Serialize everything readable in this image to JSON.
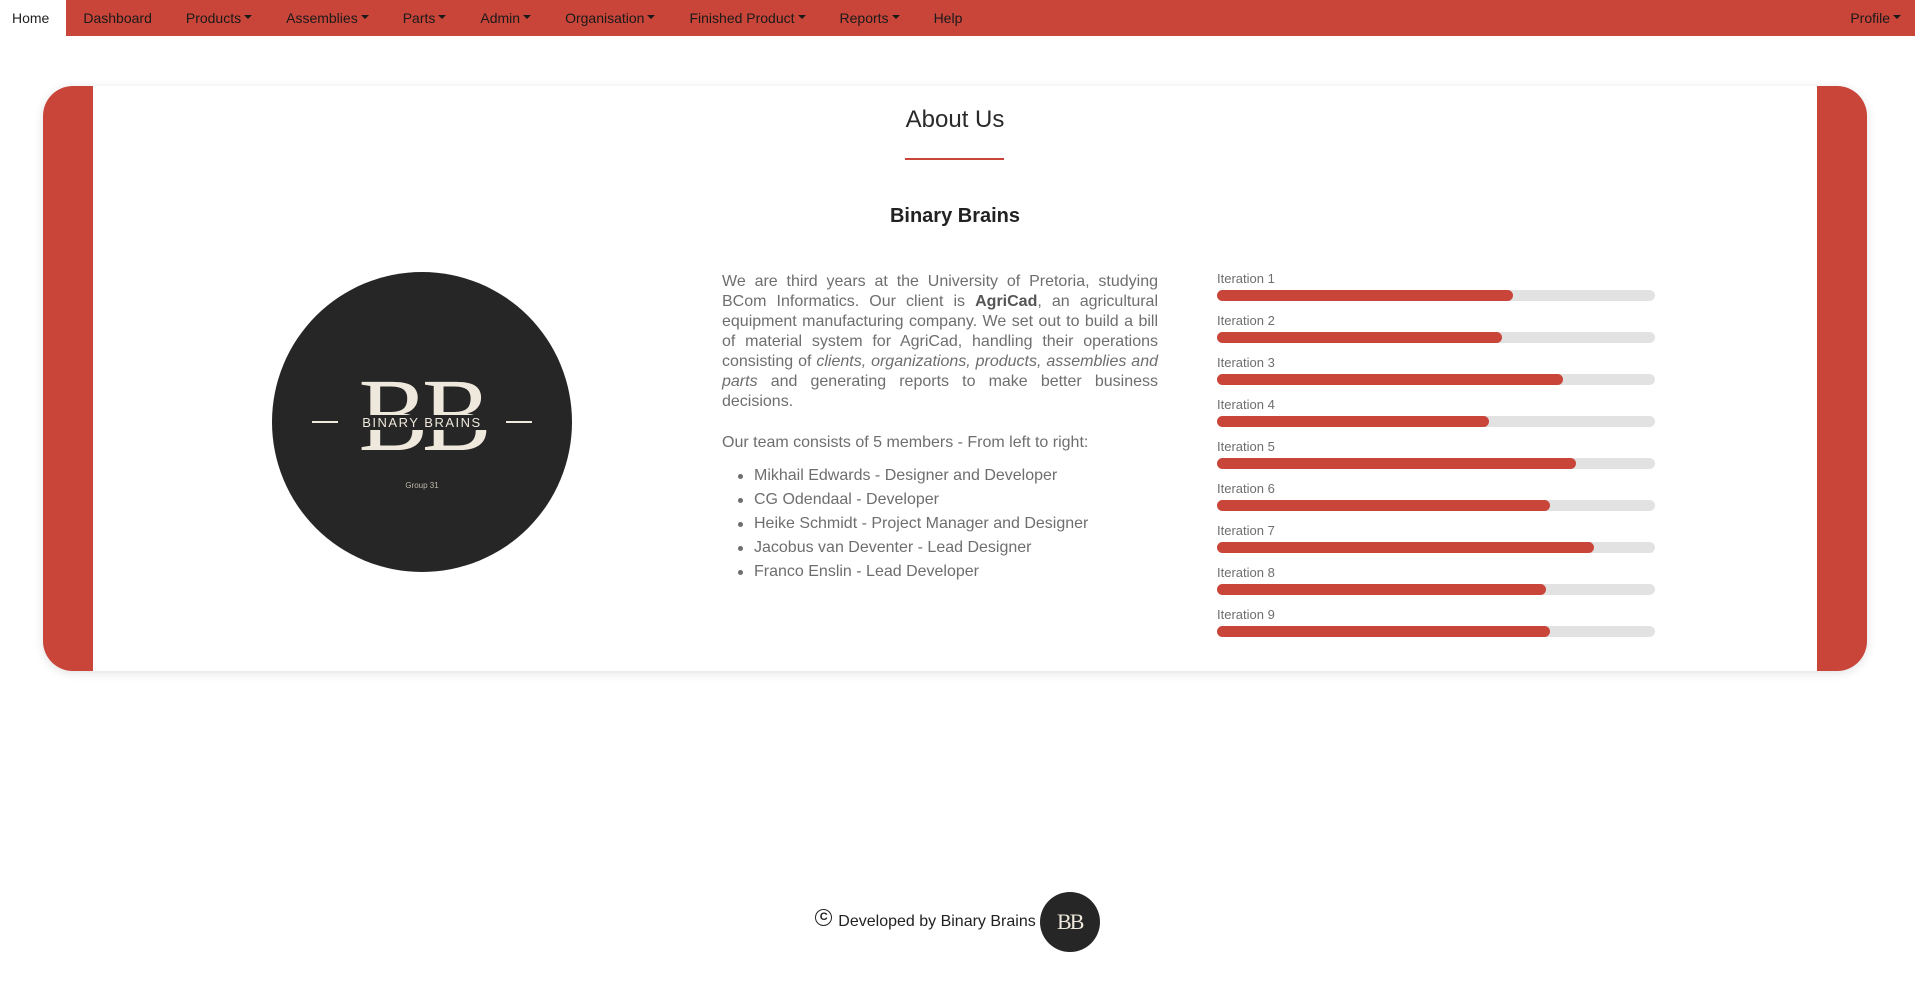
{
  "nav": {
    "items": [
      {
        "label": "Home",
        "dropdown": false,
        "active": true
      },
      {
        "label": "Dashboard",
        "dropdown": false
      },
      {
        "label": "Products",
        "dropdown": true
      },
      {
        "label": "Assemblies",
        "dropdown": true
      },
      {
        "label": "Parts",
        "dropdown": true
      },
      {
        "label": "Admin",
        "dropdown": true
      },
      {
        "label": "Organisation",
        "dropdown": true
      },
      {
        "label": "Finished Product",
        "dropdown": true
      },
      {
        "label": "Reports",
        "dropdown": true
      },
      {
        "label": "Help",
        "dropdown": false
      }
    ],
    "profile": "Profile"
  },
  "about": {
    "title": "About Us",
    "subtitle": "Binary Brains",
    "logo": {
      "letters": "BB",
      "name": "BINARY BRAINS",
      "group": "Group 31"
    },
    "description": {
      "part1": "We are third years at the University of Pretoria, studying BCom Informatics. Our client is ",
      "client": "AgriCad",
      "part2": ", an agricultural equipment manufacturing company. We set out to build a bill of material system for AgriCad, handling their operations consisting of ",
      "entities": "clients, organizations, products, assemblies and parts",
      "part3": " and generating reports to make better business decisions."
    },
    "team_intro": "Our team consists of 5 members - From left to right:",
    "team": [
      "Mikhail Edwards - Designer and Developer",
      "CG Odendaal - Developer",
      "Heike Schmidt - Project Manager and Designer",
      "Jacobus van Deventer - Lead Designer",
      "Franco Enslin - Lead Developer"
    ],
    "iterations": [
      {
        "label": "Iteration 1",
        "value": 0.675
      },
      {
        "label": "Iteration 2",
        "value": 0.65
      },
      {
        "label": "Iteration 3",
        "value": 0.79
      },
      {
        "label": "Iteration 4",
        "value": 0.62
      },
      {
        "label": "Iteration 5",
        "value": 0.82
      },
      {
        "label": "Iteration 6",
        "value": 0.76
      },
      {
        "label": "Iteration 7",
        "value": 0.86
      },
      {
        "label": "Iteration 8",
        "value": 0.75
      },
      {
        "label": "Iteration 9",
        "value": 0.76
      }
    ]
  },
  "footer": {
    "copyright_symbol": "C",
    "text": "Developed by Binary Brains",
    "logo_letters": "BB"
  },
  "colors": {
    "brand": "#c94539",
    "dark": "#262626",
    "track": "#e2e2e2"
  }
}
